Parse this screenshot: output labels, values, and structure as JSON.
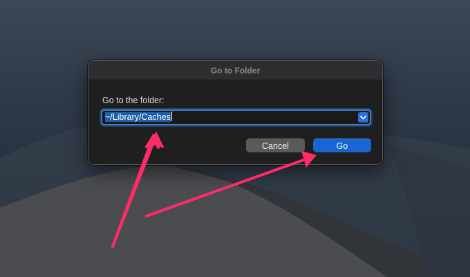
{
  "dialog": {
    "title": "Go to Folder",
    "prompt_label": "Go to the folder:",
    "path_field": {
      "value": "~/Library/Caches",
      "dropdown_icon": "chevron-down-icon"
    },
    "buttons": {
      "cancel_label": "Cancel",
      "go_label": "Go"
    }
  },
  "annotations": {
    "arrow_color": "#ff2a68",
    "arrows": [
      {
        "points_to": "path-field"
      },
      {
        "points_to": "go-button"
      }
    ]
  },
  "colors": {
    "accent_blue": "#1966d2",
    "focus_ring": "#3b7fcf",
    "dialog_bg": "#1f1f20",
    "cancel_bg": "#5a5a5c"
  }
}
